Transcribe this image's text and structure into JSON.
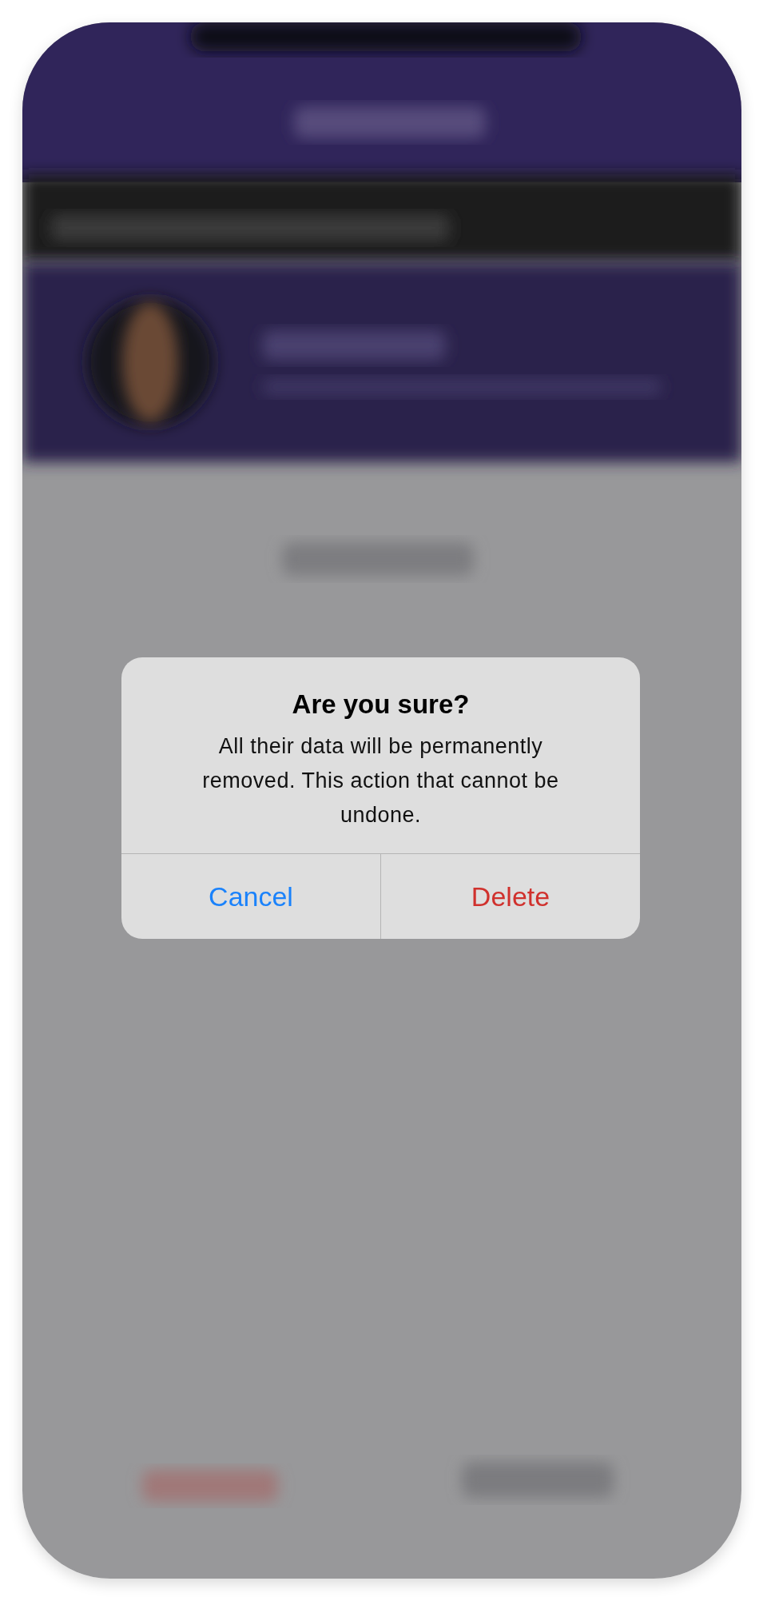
{
  "dialog": {
    "title": "Are you sure?",
    "message": "All their data will be permanently removed. This action that cannot be undone.",
    "buttons": [
      {
        "label": "Cancel",
        "kind": "cancel"
      },
      {
        "label": "Delete",
        "kind": "destructive"
      }
    ]
  }
}
